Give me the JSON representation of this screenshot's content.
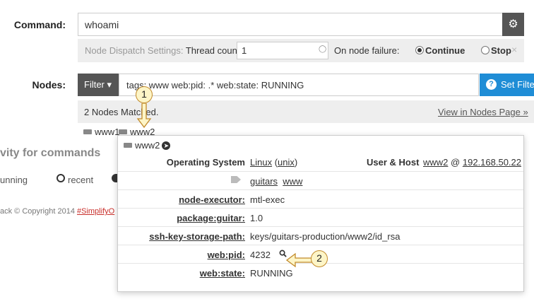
{
  "command": {
    "label": "Command:",
    "value": "whoami",
    "settings_icon": "gear-icon"
  },
  "dispatch": {
    "prefix": "Node Dispatch Settings: ",
    "thread_label": "Thread count",
    "thread_value": "1",
    "failure_label": "On node failure:",
    "continue_label": "Continue",
    "stop_label": "Stop",
    "selected": "Continue",
    "close": "×"
  },
  "nodes": {
    "label": "Nodes:",
    "filter_button": "Filter ▾",
    "filter_value": "tags: www web:pid: .* web:state: RUNNING",
    "help": "?",
    "set_filter": "Set Filter",
    "matched_text": "2 Nodes Matched.",
    "view_link": "View in Nodes Page »",
    "chips": [
      "www1",
      "www2"
    ]
  },
  "background": {
    "activity_text": "vity for commands",
    "running_text": "unning",
    "recent_text": "recent",
    "copyright_text": "ack © Copyright 2014 ",
    "copyright_link": "#SimplifyO"
  },
  "popover": {
    "title": "www2",
    "os_label": "Operating System",
    "os_value": "Linux",
    "os_family": "unix",
    "userhost_label": "User & Host",
    "user": "www2",
    "at": "@",
    "host": "192.168.50.22",
    "tags": [
      "guitars",
      "www"
    ],
    "attributes": [
      {
        "label": "node-executor:",
        "value": "mtl-exec",
        "underline": false
      },
      {
        "label": "package:guitar:",
        "value": "1.0",
        "underline": true
      },
      {
        "label": "ssh-key-storage-path:",
        "value": "keys/guitars-production/www2/id_rsa",
        "underline": true
      },
      {
        "label": "web:pid:",
        "value": "4232",
        "underline": true
      },
      {
        "label": "web:state:",
        "value": "RUNNING",
        "underline": true
      }
    ]
  },
  "callouts": [
    "1",
    "2"
  ],
  "colors": {
    "accent_blue": "#1f8dd6",
    "dark_button": "#555555",
    "callout_fill": "#fdf5c7",
    "callout_stroke": "#c28a2a"
  }
}
